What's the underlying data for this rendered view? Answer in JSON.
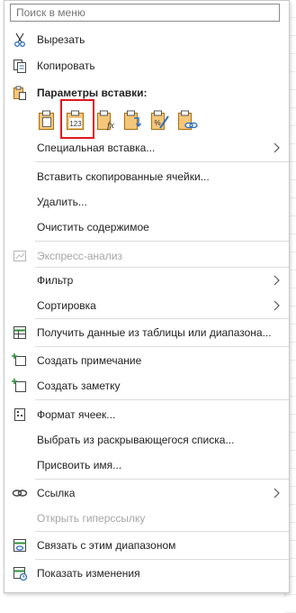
{
  "search": {
    "placeholder": "Поиск в меню"
  },
  "menu": {
    "cut": "Вырезать",
    "copy": "Копировать",
    "paste_options": "Параметры вставки:",
    "paste_special": "Специальная вставка...",
    "insert_copied_cells": "Вставить скопированные ячейки...",
    "delete": "Удалить...",
    "clear_contents": "Очистить содержимое",
    "quick_analysis": "Экспресс-анализ",
    "filter": "Фильтр",
    "sort": "Сортировка",
    "get_data": "Получить данные из таблицы или диапазона...",
    "new_comment": "Создать примечание",
    "new_note": "Создать заметку",
    "format_cells": "Формат ячеек...",
    "pick_from_list": "Выбрать из раскрывающегося списка...",
    "define_name": "Присвоить имя...",
    "link": "Ссылка",
    "open_hyperlink": "Открыть гиперссылку",
    "link_to_range": "Связать с этим диапазоном",
    "show_changes": "Показать изменения"
  },
  "paste_buttons": [
    "paste",
    "values",
    "formulas",
    "transpose",
    "formatting",
    "paste-link"
  ],
  "values_icon_text": "123",
  "colors": {
    "accent": "#e69a1f",
    "icon_blue": "#2f6fb8",
    "icon_green": "#2f8f3a",
    "highlight": "#e0181e"
  }
}
